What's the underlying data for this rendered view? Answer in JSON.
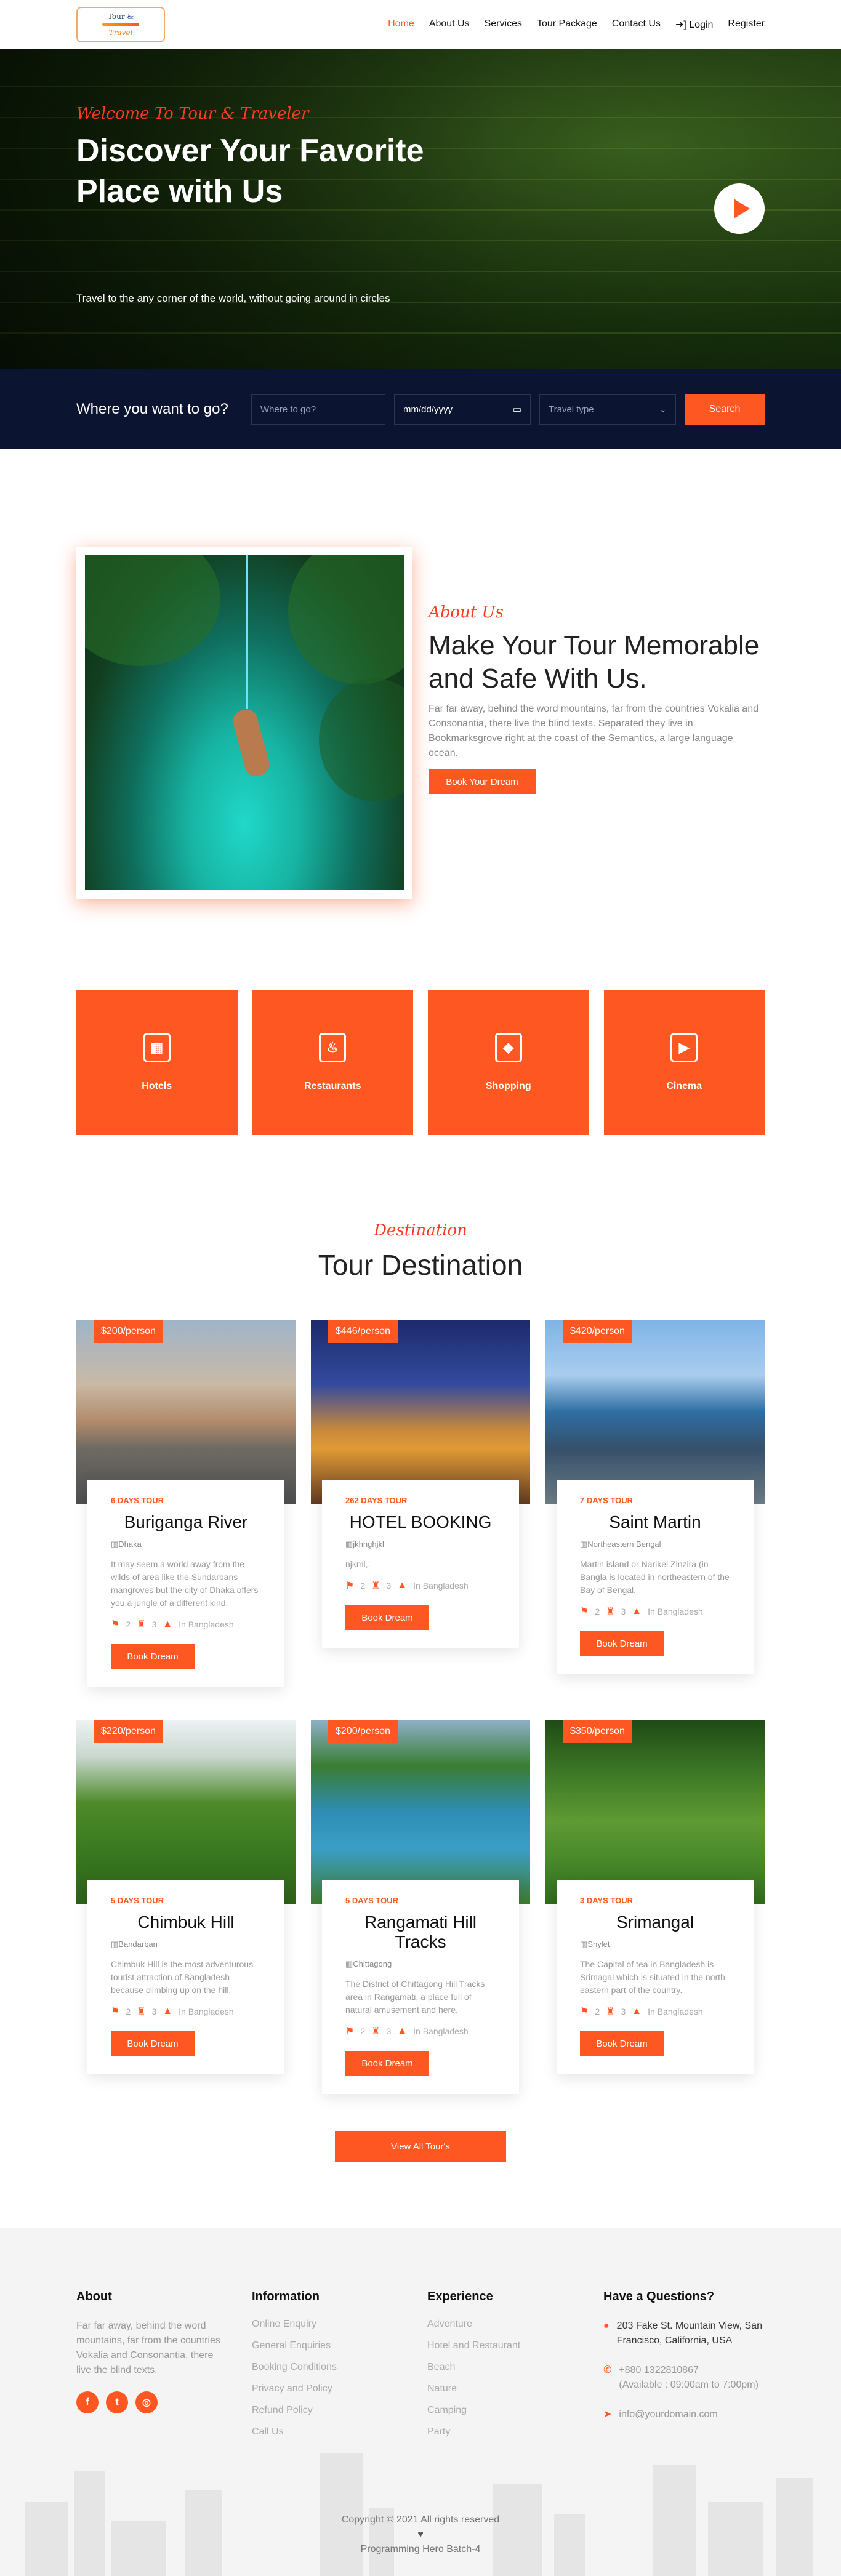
{
  "nav": {
    "logo_line1": "Tour &",
    "logo_line2": "Travel",
    "items": [
      {
        "label": "Home",
        "active": true
      },
      {
        "label": "About Us"
      },
      {
        "label": "Services"
      },
      {
        "label": "Tour Package"
      },
      {
        "label": "Contact Us"
      },
      {
        "label": "Login",
        "icon": "login-icon"
      },
      {
        "label": "Register"
      }
    ]
  },
  "hero": {
    "welcome": "Welcome To Tour & Traveler",
    "title": "Discover Your Favorite Place with Us",
    "subtitle": "Travel to the any corner of the world, without going around in circles"
  },
  "search": {
    "question": "Where you want to go?",
    "destination_placeholder": "Where to go?",
    "date_value": "mm/dd/yyyy",
    "type_value": "Travel type",
    "button": "Search"
  },
  "about": {
    "kicker": "About Us",
    "title": "Make Your Tour Memorable and Safe With Us.",
    "text": "Far far away, behind the word mountains, far from the countries Vokalia and Consonantia, there live the blind texts. Separated they live in Bookmarksgrove right at the coast of the Semantics, a large language ocean.",
    "button": "Book Your Dream"
  },
  "services": [
    {
      "label": "Hotels",
      "icon": "hotel-icon",
      "glyph": "▦"
    },
    {
      "label": "Restaurants",
      "icon": "restaurant-icon",
      "glyph": "♨"
    },
    {
      "label": "Shopping",
      "icon": "shopping-icon",
      "glyph": "◆"
    },
    {
      "label": "Cinema",
      "icon": "cinema-icon",
      "glyph": "▶"
    }
  ],
  "destination": {
    "kicker": "Destination",
    "title": "Tour Destination",
    "view_all": "View All Tour's",
    "cards": [
      {
        "price": "$200/person",
        "days": "6 DAYS TOUR",
        "name": "Buriganga River",
        "location": "Dhaka",
        "desc": "It may seem a world away from the wilds of area like the Sundarbans mangroves but the city of Dhaka offers you a jungle of a different kind.",
        "n1": "2",
        "n2": "3",
        "where": "In Bangladesh",
        "button": "Book Dream"
      },
      {
        "price": "$446/person",
        "days": "262 DAYS TOUR",
        "name": "HOTEL BOOKING",
        "location": "jkhnghjkl",
        "desc": "njkml,:",
        "n1": "2",
        "n2": "3",
        "where": "In Bangladesh",
        "button": "Book Dream"
      },
      {
        "price": "$420/person",
        "days": "7 DAYS TOUR",
        "name": "Saint Martin",
        "location": "Northeastern Bengal",
        "desc": "Martin island or Narikel Zinzira (in Bangla is located in northeastern of the Bay of Bengal.",
        "n1": "2",
        "n2": "3",
        "where": "In Bangladesh",
        "button": "Book Dream"
      },
      {
        "price": "$220/person",
        "days": "5 DAYS TOUR",
        "name": "Chimbuk Hill",
        "location": "Bandarban",
        "desc": "Chimbuk Hill is the most adventurous tourist attraction of Bangladesh because climbing up on the hill.",
        "n1": "2",
        "n2": "3",
        "where": "In Bangladesh",
        "button": "Book Dream"
      },
      {
        "price": "$200/person",
        "days": "5 DAYS TOUR",
        "name": "Rangamati Hill Tracks",
        "location": "Chittagong",
        "desc": "The District of Chittagong Hill Tracks area in Rangamati, a place full of natural amusement and here.",
        "n1": "2",
        "n2": "3",
        "where": "In Bangladesh",
        "button": "Book Dream"
      },
      {
        "price": "$350/person",
        "days": "3 DAYS TOUR",
        "name": "Srimangal",
        "location": "Shylet",
        "desc": "The Capital of tea in Bangladesh is Srimagal which is situated in the north-eastern part of the country.",
        "n1": "2",
        "n2": "3",
        "where": "In Bangladesh",
        "button": "Book Dream"
      }
    ]
  },
  "footer": {
    "about_title": "About",
    "about_text": "Far far away, behind the word mountains, far from the countries Vokalia and Consonantia, there live the blind texts.",
    "info_title": "Information",
    "info_links": [
      "Online Enquiry",
      "General Enquiries",
      "Booking Conditions",
      "Privacy and Policy",
      "Refund Policy",
      "Call Us"
    ],
    "exp_title": "Experience",
    "exp_links": [
      "Adventure",
      "Hotel and Restaurant",
      "Beach",
      "Nature",
      "Camping",
      "Party"
    ],
    "q_title": "Have a Questions?",
    "address": "203 Fake St. Mountain View, San Francisco, California, USA",
    "phone": "+880 1322810867",
    "phone_note": "(Available : 09:00am to 7:00pm)",
    "email": "info@yourdomain.com",
    "copyright": "Copyright © 2021 All rights reserved",
    "credit": "Programming Hero Batch-4"
  },
  "colors": {
    "accent": "#ff5722",
    "navy": "#0b1431"
  }
}
